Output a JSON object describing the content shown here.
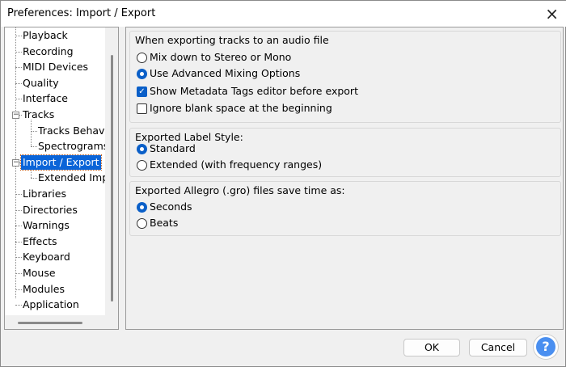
{
  "window": {
    "title": "Preferences: Import / Export",
    "close_icon": "×"
  },
  "tree": {
    "items": [
      "Playback",
      "Recording",
      "MIDI Devices",
      "Quality",
      "Interface",
      "Tracks",
      "Tracks Behavic",
      "Spectrograms",
      "Import / Export",
      "Extended Impc",
      "Libraries",
      "Directories",
      "Warnings",
      "Effects",
      "Keyboard",
      "Mouse",
      "Modules",
      "Application"
    ],
    "selected": "Import / Export"
  },
  "export_tracks": {
    "title": "When exporting tracks to an audio file",
    "mix_down": "Mix down to Stereo or Mono",
    "advanced": "Use Advanced Mixing Options",
    "metadata": "Show Metadata Tags editor before export",
    "ignore_blank": "Ignore blank space at the beginning"
  },
  "label_style": {
    "title": "Exported Label Style:",
    "standard": "Standard",
    "extended": "Extended (with frequency ranges)"
  },
  "allegro": {
    "title": "Exported Allegro (.gro) files save time as:",
    "seconds": "Seconds",
    "beats": "Beats"
  },
  "buttons": {
    "ok": "OK",
    "cancel": "Cancel",
    "help": "?"
  },
  "colors": {
    "accent": "#0a5fc8",
    "selection": "#0a64d8"
  }
}
